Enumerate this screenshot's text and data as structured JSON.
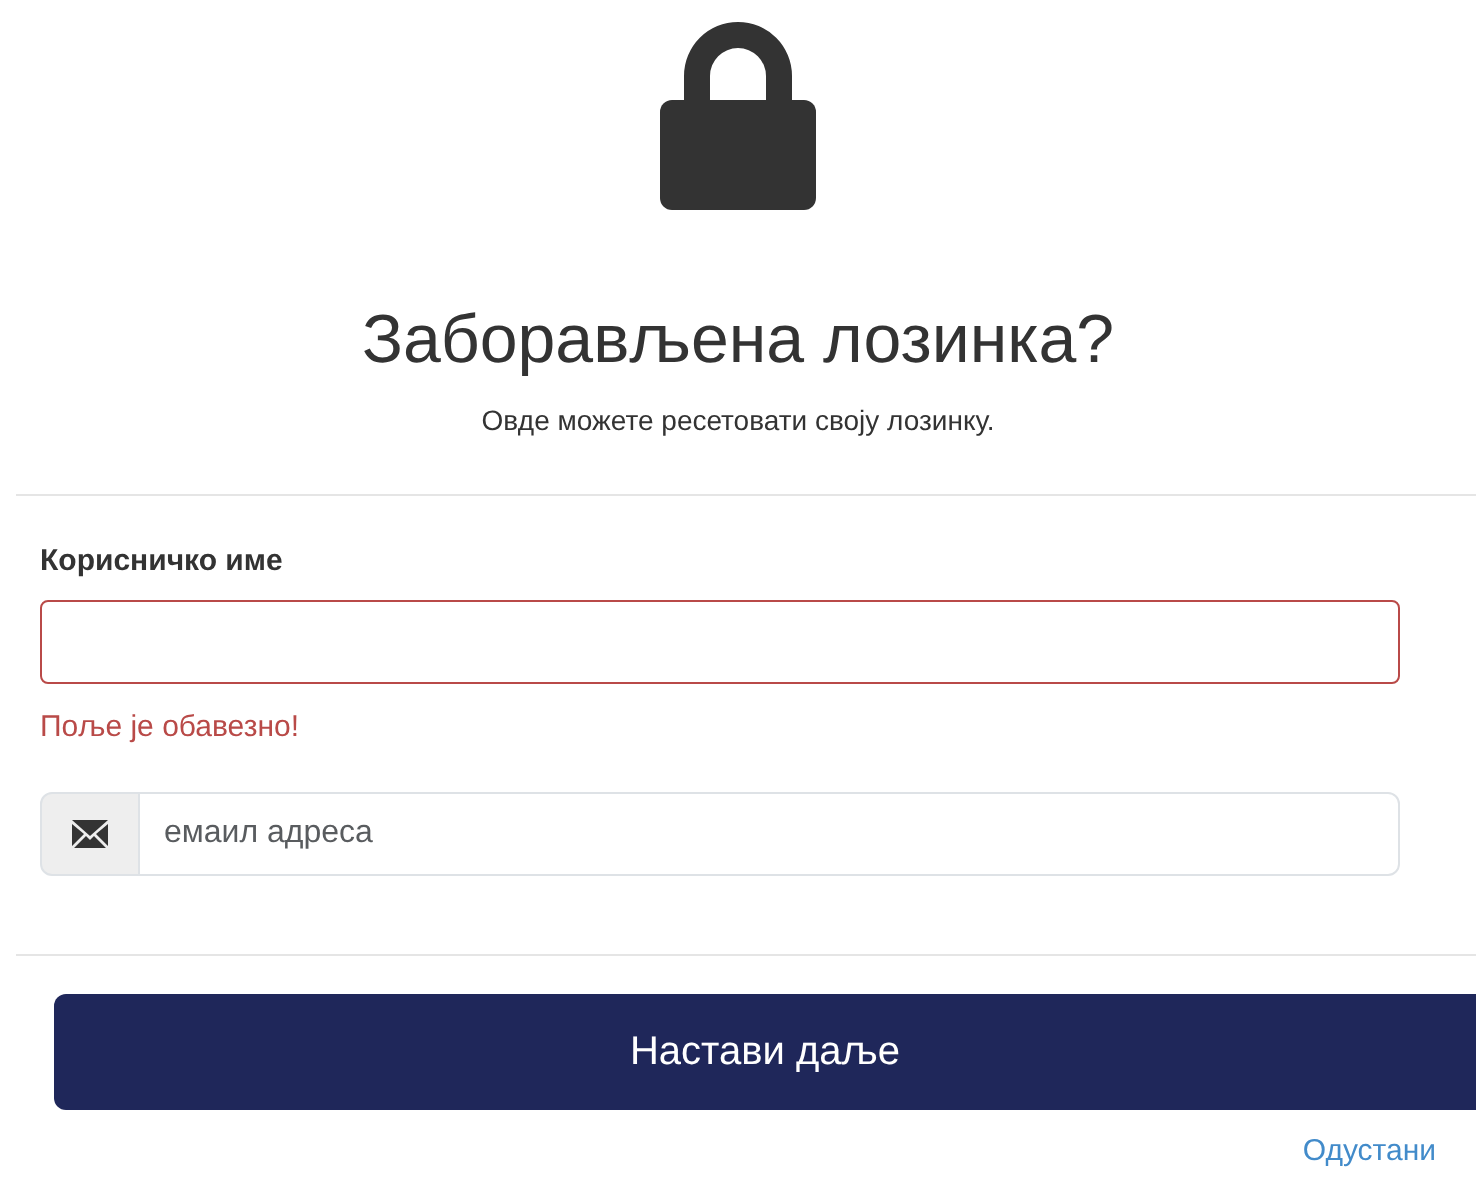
{
  "title": "Заборављена лозинка?",
  "subtitle": "Овде можете ресетовати своју лозинку.",
  "username": {
    "label": "Корисничко име",
    "invalid": true,
    "error": "Поље је обавезно!"
  },
  "email": {
    "placeholder": "емаил адреса"
  },
  "submit_button": "Настави даље",
  "cancel_link": "Одустани"
}
